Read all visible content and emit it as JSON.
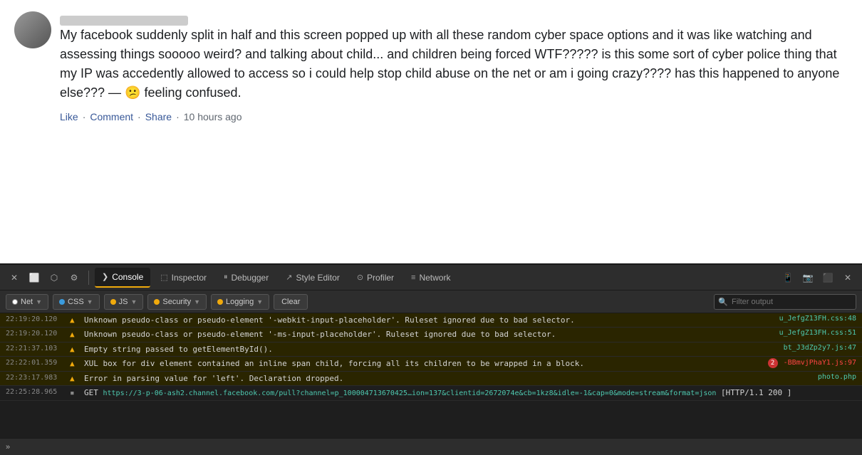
{
  "post": {
    "avatar_alt": "user avatar",
    "name_placeholder": "blurred name",
    "body": "My facebook suddenly split in half and this screen popped up with all these random cyber space options and it was like watching and assessing things sooooo weird? and talking about child... and children being forced WTF????? is this some sort of cyber police thing that my IP was accedently allowed to access so i could help stop child abuse on the net or am i going crazy???? has this happened to anyone else??? — 😕 feeling confused.",
    "actions": {
      "like": "Like",
      "comment": "Comment",
      "share": "Share",
      "time": "10 hours ago",
      "sep1": "·",
      "sep2": "·",
      "sep3": "·"
    }
  },
  "devtools": {
    "tabs": [
      {
        "label": "Console",
        "icon": "❯",
        "active": true
      },
      {
        "label": "Inspector",
        "icon": "⬚"
      },
      {
        "label": "Debugger",
        "icon": "⏸"
      },
      {
        "label": "Style Editor",
        "icon": "↗"
      },
      {
        "label": "Profiler",
        "icon": "⊙"
      },
      {
        "label": "Network",
        "icon": "≡"
      }
    ],
    "filter_bar": {
      "net_label": "Net",
      "css_label": "CSS",
      "js_label": "JS",
      "security_label": "Security",
      "logging_label": "Logging",
      "clear_label": "Clear",
      "filter_placeholder": "Filter output"
    },
    "log_rows": [
      {
        "time": "22:19:20.120",
        "type": "warning",
        "message": "Unknown pseudo-class or pseudo-element '-webkit-input-placeholder'.  Ruleset ignored due to bad selector.",
        "source": "u_JefgZ13FH.css:48"
      },
      {
        "time": "22:19:20.120",
        "type": "warning",
        "message": "Unknown pseudo-class or pseudo-element '-ms-input-placeholder'.  Ruleset ignored due to bad selector.",
        "source": "u_JefgZ13FH.css:51"
      },
      {
        "time": "22:21:37.103",
        "type": "warning",
        "message": "Empty string passed to getElementById().",
        "source": "bt_J3dZp2y7.js:47"
      },
      {
        "time": "22:22:01.359",
        "type": "warning",
        "message": "XUL box for div element contained an inline span child, forcing all its children to be wrapped in a block.",
        "source": "2 -BBmvjPhaY1.js:97",
        "has_badge": true
      },
      {
        "time": "22:23:17.983",
        "type": "warning",
        "message": "Error in parsing value for 'left'.  Declaration dropped.",
        "source": "photo.php"
      },
      {
        "time": "22:25:28.965",
        "type": "info",
        "message": "GET https://3-p-06-ash2.channel.facebook.com/pull?channel=p_1000047136704​25…ion=137&clientid=2672074e&cb=1kz8&idle=-1&cap=0&mode=stream&format=json  [HTTP/1.1 200 ]",
        "source": ""
      }
    ],
    "bottom_label": "»"
  }
}
